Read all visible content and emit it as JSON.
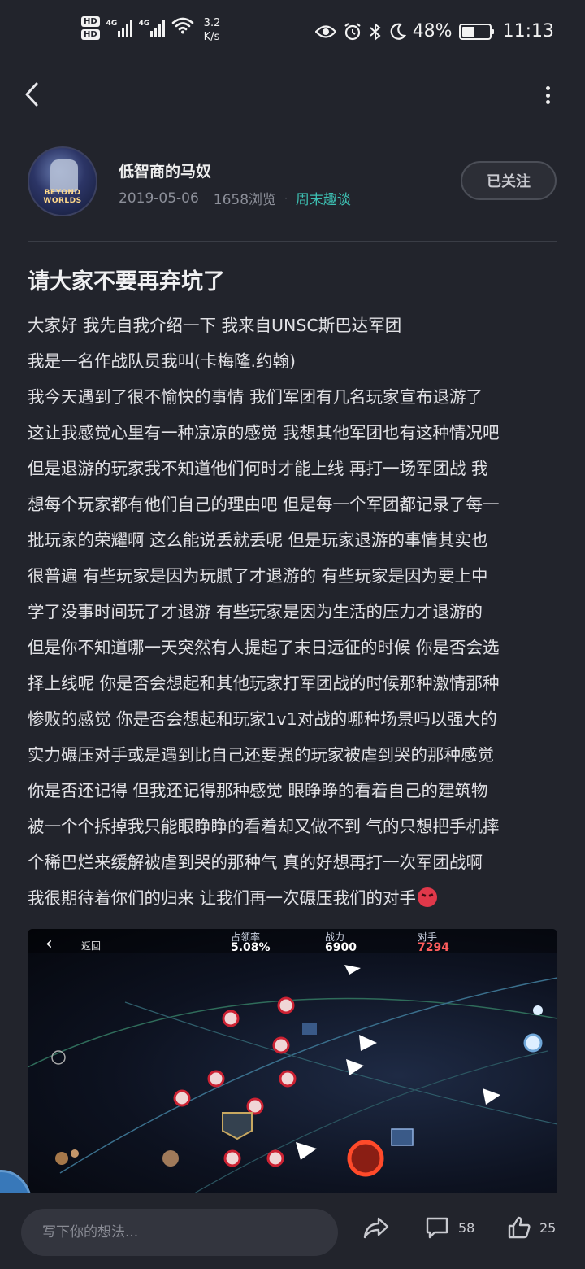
{
  "status_bar": {
    "hd1": "HD",
    "hd2": "HD",
    "net1": "4G",
    "net2": "4G",
    "speed_value": "3.2",
    "speed_unit": "K/s",
    "battery": "48%",
    "battery_level": 0.48,
    "time": "11:13"
  },
  "author": {
    "name": "低智商的马奴",
    "avatar_text": "BEYOND WORLDS",
    "date": "2019-05-06",
    "views": "1658浏览",
    "separator": "·",
    "tag": "周末趣谈",
    "follow_label": "已关注"
  },
  "post": {
    "title": "请大家不要再弃坑了",
    "lines": [
      "大家好 我先自我介绍一下 我来自UNSC斯巴达军团",
      "我是一名作战队员我叫(卡梅隆.约翰)",
      "我今天遇到了很不愉快的事情 我们军团有几名玩家宣布退游了",
      "这让我感觉心里有一种凉凉的感觉 我想其他军团也有这种情况吧",
      "但是退游的玩家我不知道他们何时才能上线 再打一场军团战 我",
      "想每个玩家都有他们自己的理由吧 但是每一个军团都记录了每一",
      "批玩家的荣耀啊 这么能说丢就丢呢 但是玩家退游的事情其实也",
      "很普遍 有些玩家是因为玩腻了才退游的 有些玩家是因为要上中",
      "学了没事时间玩了才退游 有些玩家是因为生活的压力才退游的",
      "但是你不知道哪一天突然有人提起了末日远征的时候 你是否会选",
      "择上线呢 你是否会想起和其他玩家打军团战的时候那种激情那种",
      "惨败的感觉 你是否会想起和玩家1v1对战的哪种场景吗以强大的",
      "实力碾压对手或是遇到比自己还要强的玩家被虐到哭的那种感觉",
      "你是否还记得 但我还记得那种感觉 眼睁睁的看着自己的建筑物",
      "被一个个拆掉我只能眼睁睁的看着却又做不到 气的只想把手机摔",
      "个稀巴烂来缓解被虐到哭的那种气  真的好想再打一次军团战啊",
      "我很期待着你们的归来 让我们再一次碾压我们的对手"
    ]
  },
  "game_image": {
    "back_label": "返回",
    "stat1_label": "占领率",
    "stat1_value": "5.08%",
    "stat2_label": "战力",
    "stat2_value": "6900",
    "stat3_label": "对手",
    "stat3_value": "7294"
  },
  "bottom_bar": {
    "comment_placeholder": "写下你的想法...",
    "comments_count": "58",
    "likes_count": "25"
  }
}
